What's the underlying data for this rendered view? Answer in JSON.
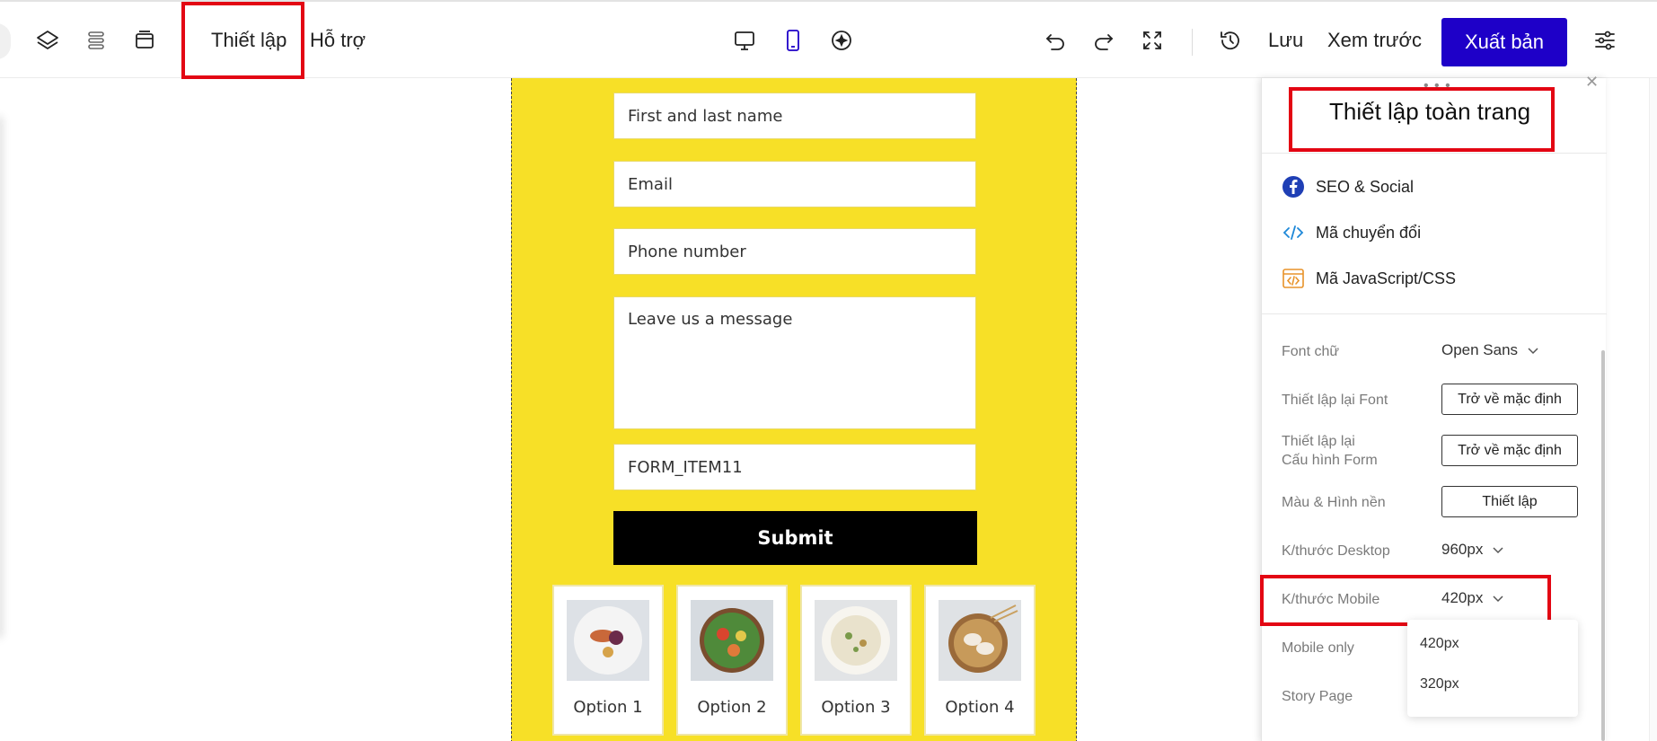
{
  "toolbar": {
    "menu_settings": "Thiết lập",
    "menu_support": "Hỗ trợ",
    "save_label": "Lưu",
    "preview_label": "Xem trước",
    "publish_label": "Xuất bản",
    "accent_color": "#1e00c8",
    "highlight_color": "#e30613"
  },
  "form": {
    "name_placeholder": "First and last name",
    "email_placeholder": "Email",
    "phone_placeholder": "Phone number",
    "message_placeholder": "Leave us a message",
    "custom_field": "FORM_ITEM11",
    "submit_label": "Submit",
    "background_color": "#f7e027",
    "options": [
      {
        "label": "Option 1"
      },
      {
        "label": "Option 2"
      },
      {
        "label": "Option 3"
      },
      {
        "label": "Option 4"
      }
    ]
  },
  "panel": {
    "title": "Thiết lập toàn trang",
    "links": [
      {
        "label": "SEO & Social",
        "icon": "facebook-icon"
      },
      {
        "label": "Mã chuyển đổi",
        "icon": "code-icon"
      },
      {
        "label": "Mã JavaScript/CSS",
        "icon": "code-window-icon"
      }
    ],
    "font_label": "Font chữ",
    "font_value": "Open Sans",
    "reset_font_label": "Thiết lập lại Font",
    "reset_font_button": "Trở về mặc định",
    "reset_form_label_line1": "Thiết lập lại",
    "reset_form_label_line2": "Cấu hình Form",
    "reset_form_button": "Trở về mặc định",
    "color_label": "Màu & Hình nền",
    "color_button": "Thiết lập",
    "desktop_label": "K/thước Desktop",
    "desktop_value": "960px",
    "mobile_label": "K/thước Mobile",
    "mobile_value": "420px",
    "mobile_only_label": "Mobile only",
    "story_page_label": "Story Page",
    "mobile_options": [
      "420px",
      "320px"
    ]
  }
}
